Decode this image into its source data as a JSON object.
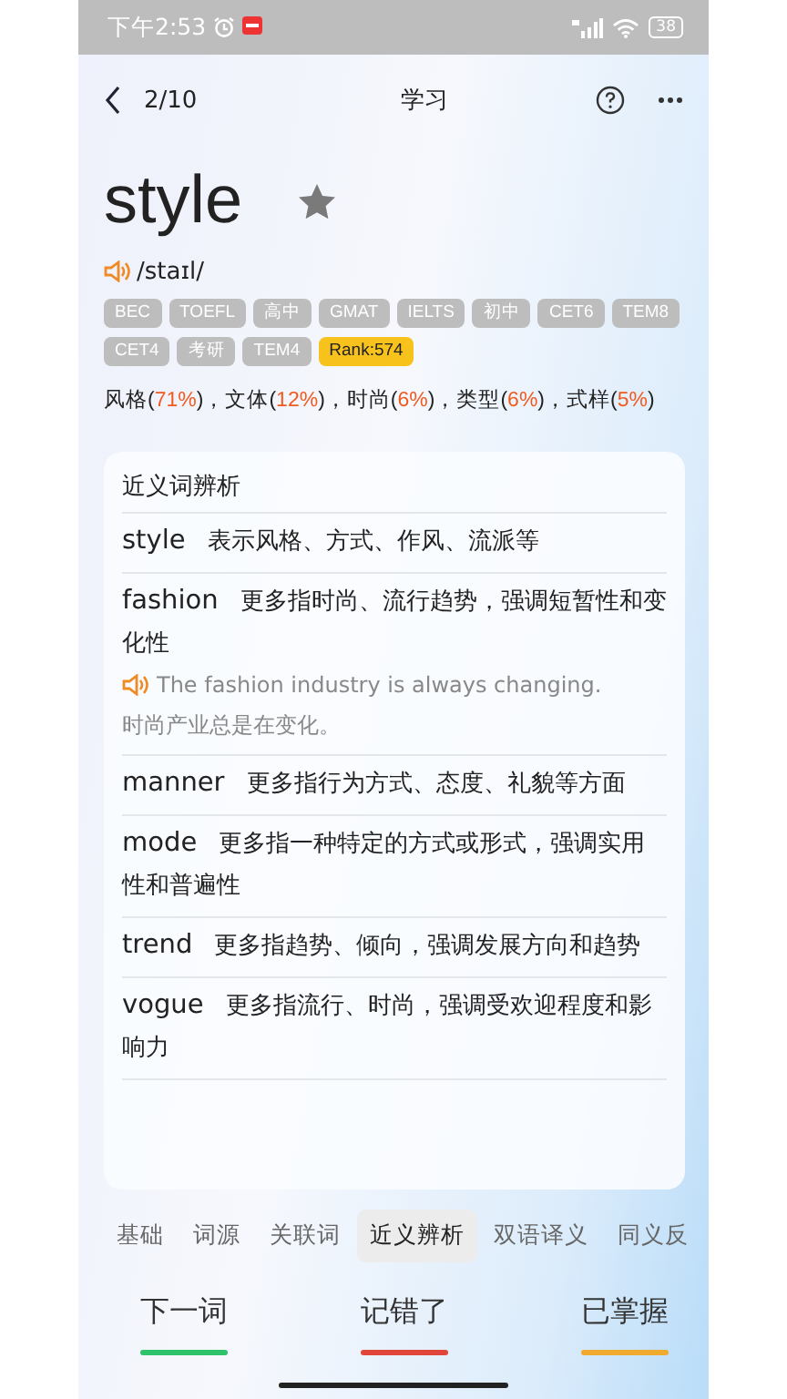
{
  "status_bar": {
    "time": "下午2:53",
    "battery": "38"
  },
  "header": {
    "progress": "2/10",
    "title": "学习"
  },
  "word": {
    "text": "style",
    "starred": false,
    "phonetic": "/staɪl/"
  },
  "tags": [
    {
      "label": "BEC",
      "kind": "level"
    },
    {
      "label": "TOEFL",
      "kind": "level"
    },
    {
      "label": "高中",
      "kind": "level"
    },
    {
      "label": "GMAT",
      "kind": "level"
    },
    {
      "label": "IELTS",
      "kind": "level"
    },
    {
      "label": "初中",
      "kind": "level"
    },
    {
      "label": "CET6",
      "kind": "level"
    },
    {
      "label": "TEM8",
      "kind": "level"
    },
    {
      "label": "CET4",
      "kind": "level"
    },
    {
      "label": "考研",
      "kind": "level"
    },
    {
      "label": "TEM4",
      "kind": "level"
    },
    {
      "label": "Rank:574",
      "kind": "rank"
    }
  ],
  "meanings": "风格(**71%**)，文体(**12%**)，时尚(**6%**)，类型(**6%**)，式样(**5%**)",
  "card": {
    "title": "近义词辨析",
    "rows": [
      {
        "word": "style",
        "text": "表示风格、方式、作风、流派等"
      },
      {
        "word": "fashion",
        "text": "更多指时尚、流行趋势，强调短暂性和变化性",
        "example": "The fashion industry is always changing.",
        "translation": "时尚产业总是在变化。"
      },
      {
        "word": "manner",
        "text": "更多指行为方式、态度、礼貌等方面"
      },
      {
        "word": "mode",
        "text": "更多指一种特定的方式或形式，强调实用性和普遍性"
      },
      {
        "word": "trend",
        "text": "更多指趋势、倾向，强调发展方向和趋势"
      },
      {
        "word": "vogue",
        "text": "更多指流行、时尚，强调受欢迎程度和影响力"
      }
    ]
  },
  "tabs": [
    {
      "label": "基础",
      "selected": false
    },
    {
      "label": "词源",
      "selected": false
    },
    {
      "label": "关联词",
      "selected": false
    },
    {
      "label": "近义辨析",
      "selected": true
    },
    {
      "label": "双语译义",
      "selected": false
    },
    {
      "label": "同义反",
      "selected": false
    }
  ],
  "actions": [
    {
      "label": "下一词",
      "color": "#2ec26a"
    },
    {
      "label": "记错了",
      "color": "#e0473a"
    },
    {
      "label": "已掌握",
      "color": "#f0aa30"
    }
  ]
}
